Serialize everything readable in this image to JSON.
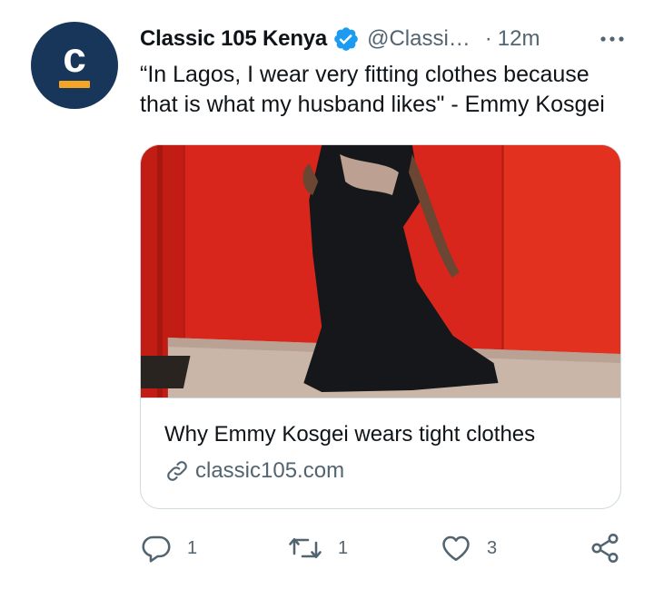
{
  "account": {
    "display_name": "Classic 105 Kenya",
    "handle": "@Classi…",
    "separator": "·",
    "timestamp": "12m",
    "avatar_letter": "c",
    "brand_color": "#17365a",
    "accent_color": "#f5a524",
    "verified_color": "#1d9bf0"
  },
  "tweet": {
    "text": "“In Lagos, I wear very fitting clothes because that is what my husband likes\" - Emmy Kosgei"
  },
  "card": {
    "title": "Why Emmy Kosgei wears tight clothes",
    "domain": "classic105.com",
    "link_icon": "link-icon"
  },
  "actions": {
    "reply_count": "1",
    "retweet_count": "1",
    "like_count": "3",
    "icons": [
      "reply-icon",
      "retweet-icon",
      "like-icon",
      "share-icon"
    ]
  }
}
